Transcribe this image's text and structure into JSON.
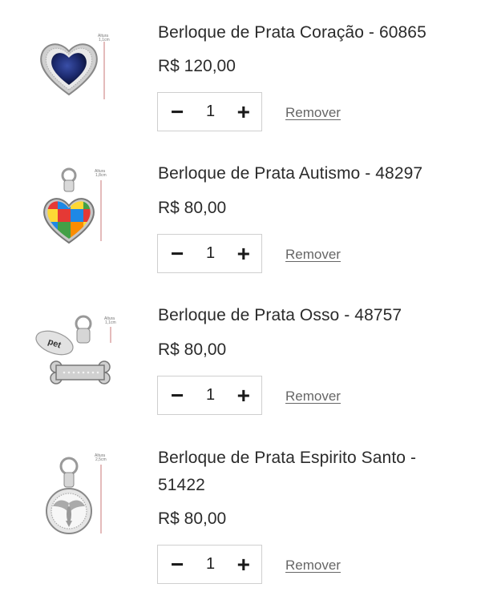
{
  "cart": {
    "items": [
      {
        "name": "Berloque de Prata Coração - 60865",
        "price": "R$ 120,00",
        "quantity": "1",
        "remove_label": "Remover",
        "image_label_1": "Altura",
        "image_label_2": "1,1cm"
      },
      {
        "name": "Berloque de Prata Autismo - 48297",
        "price": "R$ 80,00",
        "quantity": "1",
        "remove_label": "Remover",
        "image_label_1": "Altura",
        "image_label_2": "1,8cm"
      },
      {
        "name": "Berloque de Prata Osso - 48757",
        "price": "R$ 80,00",
        "quantity": "1",
        "remove_label": "Remover",
        "image_label_1": "Altura",
        "image_label_2": "1,1cm",
        "image_tag_text": "pet"
      },
      {
        "name": "Berloque de Prata Espirito Santo - 51422",
        "price": "R$ 80,00",
        "quantity": "1",
        "remove_label": "Remover",
        "image_label_1": "Altura",
        "image_label_2": "2,5cm"
      }
    ],
    "decrement_symbol": "−",
    "increment_symbol": "+"
  }
}
